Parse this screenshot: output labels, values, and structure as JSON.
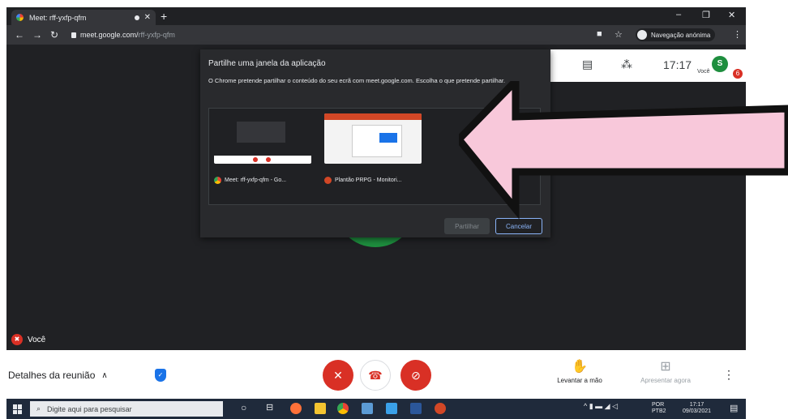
{
  "browser": {
    "tab_title": "Meet: rff-yxfp-qfm",
    "url_host": "meet.google.com/",
    "url_path": "rff-yxfp-qfm",
    "incognito_label": "Navegação anónima"
  },
  "meet": {
    "time": "17:17",
    "avatar_initial": "S",
    "you_label": "Você",
    "alert_count": "6",
    "self_name": "Você",
    "meeting_details": "Detalhes da reunião",
    "raise_hand": "Levantar a mão",
    "present_now": "Apresentar agora"
  },
  "dialog": {
    "title": "Partilhe uma janela da aplicação",
    "description": "O Chrome pretende partilhar o conteúdo do seu ecrã com meet.google.com. Escolha o que pretende partilhar.",
    "windows": [
      {
        "label": "Meet: rff-yxfp-qfm - Go..."
      },
      {
        "label": "Plantão PRPG - Monitori..."
      }
    ],
    "share_button": "Partilhar",
    "cancel_button": "Cancelar"
  },
  "taskbar": {
    "search_placeholder": "Digite aqui para pesquisar",
    "language": "POR",
    "layout": "PTB2",
    "clock_time": "17:17",
    "clock_date": "09/03/2021"
  },
  "colors": {
    "meet_dark": "#202124",
    "danger_red": "#d93025",
    "meet_green": "#1e8e3e",
    "arrow_pink": "#f8c8da",
    "taskbar": "#1f2a3b"
  }
}
